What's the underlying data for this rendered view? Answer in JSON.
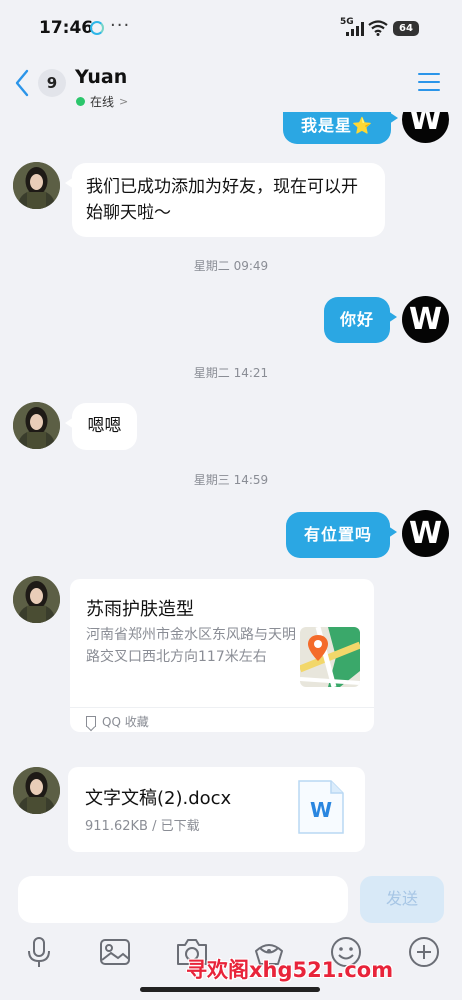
{
  "status_bar": {
    "time": "17:46",
    "dots": "···",
    "network": "5G",
    "battery": "64"
  },
  "header": {
    "unread_count": "9",
    "contact_name": "Yuan",
    "online_status": "在线",
    "status_chevron": ">",
    "accent_color": "#2b95e9",
    "online_color": "#2cc66c"
  },
  "messages": {
    "m0_self_text": "我是星⭐",
    "m1_friend_text": "我们已成功添加为好友，现在可以开始聊天啦～",
    "ts1": "星期二 09:49",
    "m2_self_text": "你好",
    "ts2": "星期二 14:21",
    "m3_friend_text": "嗯嗯",
    "ts3": "星期三 14:59",
    "m4_self_text": "有位置吗",
    "self_avatar_letter": "W",
    "self_bubble_color": "#2ba7e3"
  },
  "location_card": {
    "title": "苏雨护肤造型",
    "address": "河南省郑州市金水区东风路与天明路交叉口西北方向117米左右",
    "source": "QQ 收藏",
    "icon": "map-pin-icon"
  },
  "file_card": {
    "name": "文字文稿(2).docx",
    "meta": "911.62KB / 已下载",
    "icon": "word-doc-icon",
    "icon_letter": "W"
  },
  "input": {
    "placeholder": "",
    "send_label": "发送"
  },
  "toolbar": {
    "icons": [
      "microphone-icon",
      "image-icon",
      "camera-icon",
      "red-packet-icon",
      "emoji-icon",
      "plus-icon"
    ]
  },
  "watermark": "寻欢阁xhg521.com"
}
